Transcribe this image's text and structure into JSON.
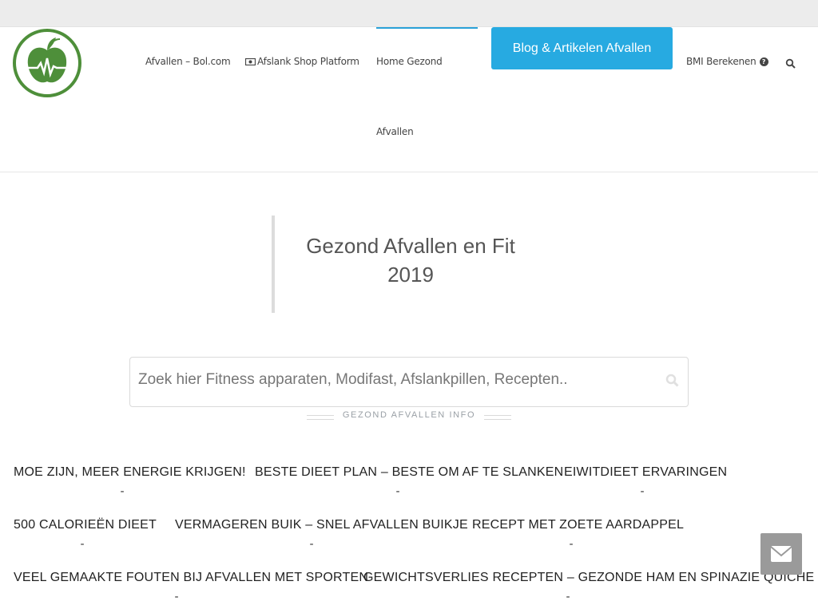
{
  "nav": {
    "items": [
      {
        "label": "Afvallen – Bol.com"
      },
      {
        "label": "Afslank Shop Platform"
      },
      {
        "label": "Home Gezond"
      },
      {
        "label": "Afvallen"
      },
      {
        "label": "BMI Berekenen"
      }
    ],
    "cta_label": "Blog & Artikelen Afvallen",
    "help_icon": "?"
  },
  "hero": {
    "title_line1": "Gezond Afvallen en Fit",
    "title_line2": "2019"
  },
  "search": {
    "placeholder": "Zoek hier Fitness apparaten, Modifast, Afslankpillen, Recepten.."
  },
  "section": {
    "label": "GEZOND AFVALLEN INFO"
  },
  "posts": [
    {
      "title": "MOE ZIJN, MEER ENERGIE KRIJGEN!",
      "sep": "-"
    },
    {
      "title": "BESTE DIEET PLAN – BESTE OM AF TE SLANKEN",
      "sep": "-"
    },
    {
      "title": "EIWITDIEET ERVARINGEN",
      "sep": "-"
    },
    {
      "title": "500 CALORIEËN DIEET",
      "sep": "-"
    },
    {
      "title": "VERMAGEREN BUIK – SNEL AFVALLEN BUIKJE",
      "sep": "-"
    },
    {
      "title": "RECEPT MET ZOETE AARDAPPEL",
      "sep": "-"
    },
    {
      "title": "VEEL GEMAAKTE FOUTEN BIJ AFVALLEN MET SPORTEN",
      "sep": "-"
    },
    {
      "title": "GEWICHTSVERLIES RECEPTEN – GEZONDE HAM EN SPINAZIE QUICHE",
      "sep": "-"
    }
  ],
  "colors": {
    "brand_green": "#4e8f3a",
    "accent_blue": "#27aae1",
    "contact_grey": "#9a9a9a"
  },
  "icons": {
    "logo": "apple-heartbeat-logo",
    "shop": "money-icon",
    "help": "question-circle-icon",
    "search": "search-icon",
    "contact": "envelope-icon"
  }
}
